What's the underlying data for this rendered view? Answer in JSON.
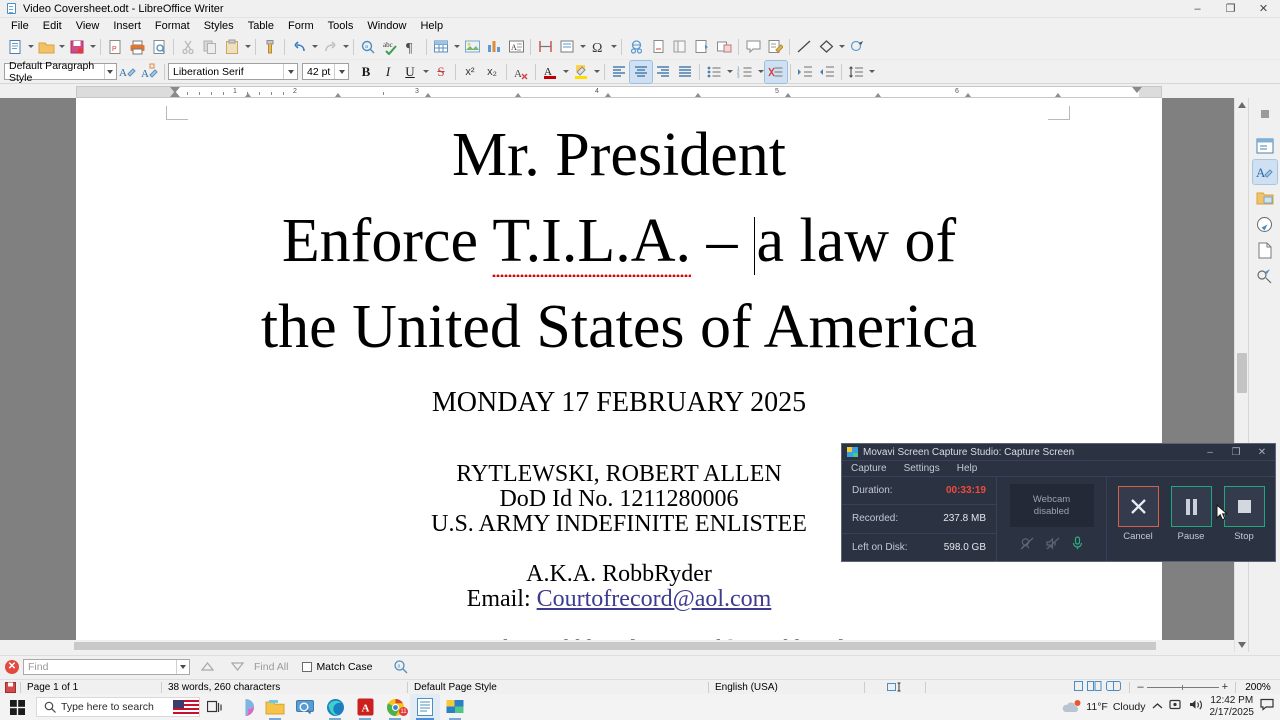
{
  "window": {
    "title": "Video Coversheet.odt - LibreOffice Writer",
    "minimize": "–",
    "maximize": "❐",
    "close": "✕"
  },
  "menubar": {
    "items": [
      "File",
      "Edit",
      "View",
      "Insert",
      "Format",
      "Styles",
      "Table",
      "Form",
      "Tools",
      "Window",
      "Help"
    ]
  },
  "formatting": {
    "paragraph_style": "Default Paragraph Style",
    "font_name": "Liberation Serif",
    "font_size": "42 pt",
    "bold": "B",
    "italic": "I",
    "underline": "U",
    "strikethrough": "S",
    "superscript": "x²",
    "subscript": "x₂"
  },
  "document": {
    "line1": "Mr. President",
    "line2_a": "Enforce ",
    "line2_misspelled": "T.I.L.A.",
    "line2_b": " – ",
    "line2_c": "a law of",
    "line3": "the United States of America",
    "date": "MONDAY 17 FEBRUARY 2025",
    "name": "RYTLEWSKI, ROBERT ALLEN",
    "dod_id": "DoD Id No. 1211280006",
    "status": "U.S. ARMY INDEFINITE ENLISTEE",
    "aka": "A.K.A. RobbRyder",
    "email_label": "Email: ",
    "email": "Courtofrecord@aol.com",
    "social": "“X” & YouTube: RobbbRyder / Rumble: RobbRyder"
  },
  "findbar": {
    "close": "✕",
    "placeholder": "Find",
    "find_all": "Find All",
    "match_case": "Match Case"
  },
  "statusbar": {
    "page": "Page 1 of 1",
    "words": "38 words, 260 characters",
    "page_style": "Default Page Style",
    "language": "English (USA)",
    "zoom": "200%",
    "zoom_minus": "–",
    "zoom_plus": "+"
  },
  "ruler": {
    "numbers": [
      "1",
      "2",
      "3",
      "4",
      "5",
      "6"
    ]
  },
  "movavi": {
    "title": "Movavi Screen Capture Studio: Capture Screen",
    "minimize": "–",
    "maximize": "❐",
    "close": "✕",
    "menu": [
      "Capture",
      "Settings",
      "Help"
    ],
    "duration_label": "Duration:",
    "duration_value": "00:33:19",
    "recorded_label": "Recorded:",
    "recorded_value": "237.8 MB",
    "disk_label": "Left on Disk:",
    "disk_value": "598.0 GB",
    "webcam_line1": "Webcam",
    "webcam_line2": "disabled",
    "buttons": [
      {
        "label": "Cancel",
        "icon": "close-icon"
      },
      {
        "label": "Pause",
        "icon": "pause-icon"
      },
      {
        "label": "Stop",
        "icon": "stop-icon"
      }
    ],
    "colors": {
      "cancel": "#d4604a",
      "pause": "#1fa87f",
      "stop": "#1fa87f",
      "duration": "#ef4b3c",
      "mic_on": "#2fae84"
    }
  },
  "taskbar": {
    "search_placeholder": "Type here to search",
    "weather_temp": "11°F",
    "weather_cond": "Cloudy",
    "time": "12:42 PM",
    "date": "2/17/2025"
  }
}
